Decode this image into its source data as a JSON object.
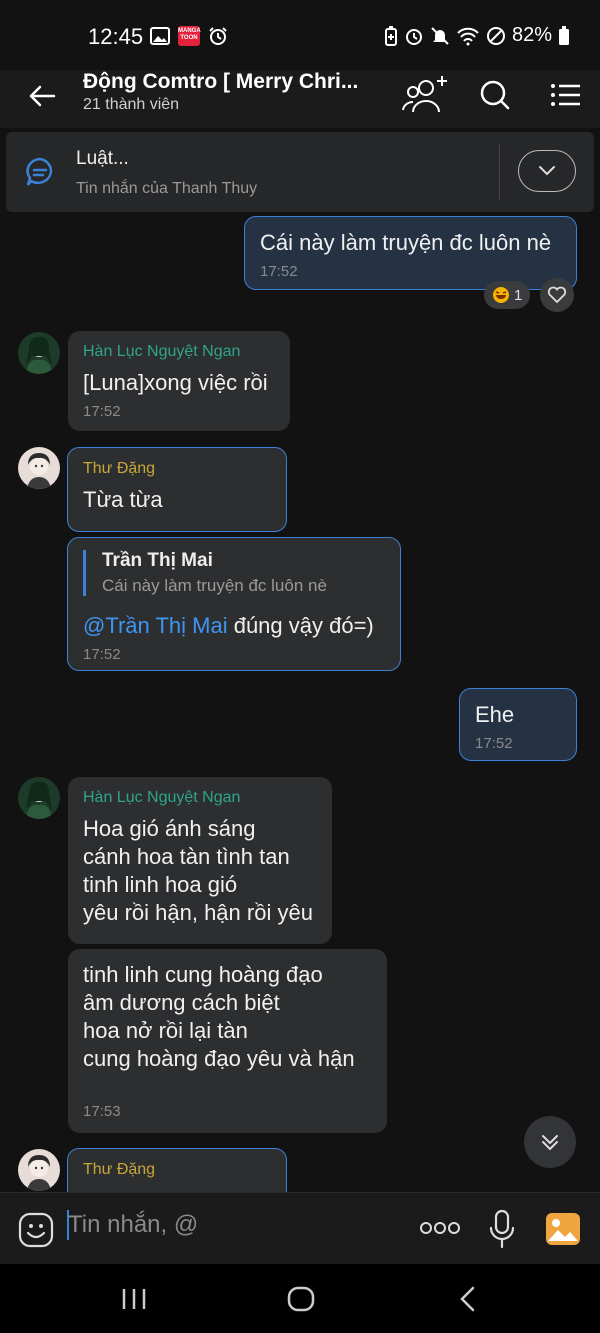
{
  "status_bar": {
    "time": "12:45",
    "battery": "82%",
    "manga_badge": "MANGA TOON"
  },
  "header": {
    "title": "Động Comtro [ Merry Chri...",
    "subtitle": "21 thành viên"
  },
  "pinned": {
    "title": "Luật...",
    "subtitle": "Tin nhắn của Thanh Thuy"
  },
  "messages": [
    {
      "text": "Cái này làm truyện đc luôn nè",
      "time": "17:52",
      "reaction_count": "1"
    },
    {
      "sender": "Hàn Lục Nguyệt Ngan",
      "text": "[Luna]xong việc rồi",
      "time": "17:52"
    },
    {
      "sender": "Thư Đặng",
      "text": "Từa từa"
    },
    {
      "quote_name": "Trần Thị Mai",
      "quote_text": "Cái này làm truyện đc luôn nè",
      "mention": "@Trần Thị Mai",
      "text": " đúng vậy đó=)",
      "time": "17:52"
    },
    {
      "text": "Ehe",
      "time": "17:52"
    },
    {
      "sender": "Hàn Lục Nguyệt Ngan",
      "text": "Hoa gió ánh sáng\ncánh hoa tàn tình tan\ntinh linh hoa gió\nyêu rồi hận, hận rồi yêu"
    },
    {
      "text": "tinh linh cung hoàng đạo\nâm dương cách biệt\nhoa nở rồi lại tàn\ncung hoàng đạo yêu và hận",
      "time": "17:53"
    },
    {
      "sender": "Thư Đặng"
    }
  ],
  "input": {
    "placeholder": "Tin nhắn, @"
  },
  "colors": {
    "accent": "#3b82d6",
    "sender_green": "#2ea58a",
    "sender_yellow": "#c8a63a",
    "mention": "#3e96f2"
  }
}
